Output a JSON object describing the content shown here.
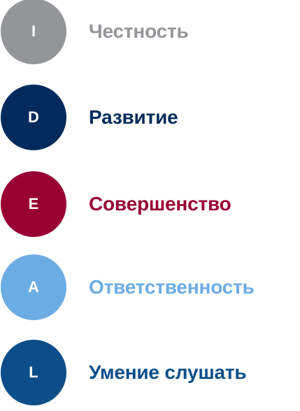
{
  "values": [
    {
      "letter": "I",
      "label": "Честность",
      "color": "#939598"
    },
    {
      "letter": "D",
      "label": "Развитие",
      "color": "#002B5C"
    },
    {
      "letter": "E",
      "label": "Совершенство",
      "color": "#980032"
    },
    {
      "letter": "A",
      "label": "Ответственность",
      "color": "#6BACE4"
    },
    {
      "letter": "L",
      "label": "Умение слушать",
      "color": "#0B4E89"
    }
  ]
}
